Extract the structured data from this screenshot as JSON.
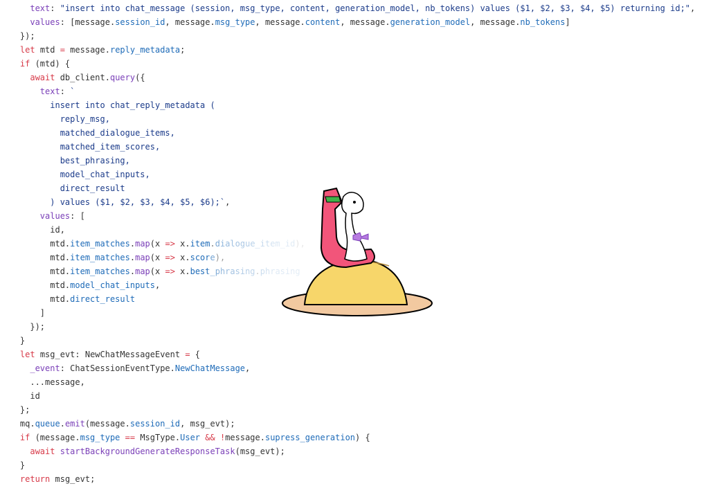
{
  "editor": {
    "lines": [
      [
        {
          "t": "      "
        },
        {
          "t": "text",
          "c": "prop"
        },
        {
          "t": ": "
        },
        {
          "t": "\"insert into chat_message (session, msg_type, content, generation_model, nb_tokens) values ($1, $2, $3, $4, $5) returning id;\"",
          "c": "str"
        },
        {
          "t": ","
        }
      ],
      [
        {
          "t": "      "
        },
        {
          "t": "values",
          "c": "prop"
        },
        {
          "t": ": [message."
        },
        {
          "t": "session_id",
          "c": "field"
        },
        {
          "t": ", message."
        },
        {
          "t": "msg_type",
          "c": "field"
        },
        {
          "t": ", message."
        },
        {
          "t": "content",
          "c": "field"
        },
        {
          "t": ", message."
        },
        {
          "t": "generation_model",
          "c": "field"
        },
        {
          "t": ", message."
        },
        {
          "t": "nb_tokens",
          "c": "field"
        },
        {
          "t": "]"
        }
      ],
      [
        {
          "t": "    });"
        }
      ],
      [
        {
          "t": "    "
        },
        {
          "t": "let",
          "c": "kw"
        },
        {
          "t": " mtd "
        },
        {
          "t": "=",
          "c": "op"
        },
        {
          "t": " message."
        },
        {
          "t": "reply_metadata",
          "c": "field"
        },
        {
          "t": ";"
        }
      ],
      [
        {
          "t": "    "
        },
        {
          "t": "if",
          "c": "kw"
        },
        {
          "t": " (mtd) {"
        }
      ],
      [
        {
          "t": "      "
        },
        {
          "t": "await",
          "c": "kw"
        },
        {
          "t": " db_client."
        },
        {
          "t": "query",
          "c": "fn"
        },
        {
          "t": "({"
        }
      ],
      [
        {
          "t": "        "
        },
        {
          "t": "text",
          "c": "prop"
        },
        {
          "t": ": "
        },
        {
          "t": "`",
          "c": "str"
        }
      ],
      [
        {
          "t": "          "
        },
        {
          "t": "insert into chat_reply_metadata (",
          "c": "str"
        }
      ],
      [
        {
          "t": "            "
        },
        {
          "t": "reply_msg,",
          "c": "str"
        }
      ],
      [
        {
          "t": "            "
        },
        {
          "t": "matched_dialogue_items,",
          "c": "str"
        }
      ],
      [
        {
          "t": "            "
        },
        {
          "t": "matched_item_scores,",
          "c": "str"
        }
      ],
      [
        {
          "t": "            "
        },
        {
          "t": "best_phrasing,",
          "c": "str"
        }
      ],
      [
        {
          "t": "            "
        },
        {
          "t": "model_chat_inputs,",
          "c": "str"
        }
      ],
      [
        {
          "t": "            "
        },
        {
          "t": "direct_result",
          "c": "str"
        }
      ],
      [
        {
          "t": "          "
        },
        {
          "t": ") values ($1, $2, $3, $4, $5, $6);`",
          "c": "str"
        },
        {
          "t": ","
        }
      ],
      [
        {
          "t": "        "
        },
        {
          "t": "values",
          "c": "prop"
        },
        {
          "t": ": ["
        }
      ],
      [
        {
          "t": "          id,"
        }
      ],
      [
        {
          "t": "          mtd."
        },
        {
          "t": "item_matches",
          "c": "field"
        },
        {
          "t": "."
        },
        {
          "t": "map",
          "c": "fn"
        },
        {
          "t": "(x "
        },
        {
          "t": "=>",
          "c": "op"
        },
        {
          "t": " x."
        },
        {
          "t": "item",
          "c": "field"
        },
        {
          "t": "."
        },
        {
          "t": "dialogue_item_id",
          "c": "field"
        },
        {
          "t": "),"
        }
      ],
      [
        {
          "t": "          mtd."
        },
        {
          "t": "item_matches",
          "c": "field"
        },
        {
          "t": "."
        },
        {
          "t": "map",
          "c": "fn"
        },
        {
          "t": "(x "
        },
        {
          "t": "=>",
          "c": "op"
        },
        {
          "t": " x."
        },
        {
          "t": "score",
          "c": "field"
        },
        {
          "t": "),"
        }
      ],
      [
        {
          "t": "          mtd."
        },
        {
          "t": "item_matches",
          "c": "field"
        },
        {
          "t": "."
        },
        {
          "t": "map",
          "c": "fn"
        },
        {
          "t": "(x "
        },
        {
          "t": "=>",
          "c": "op"
        },
        {
          "t": " x."
        },
        {
          "t": "best_phrasing",
          "c": "field"
        },
        {
          "t": "."
        },
        {
          "t": "phrasing",
          "c": "field"
        }
      ],
      [
        {
          "t": "          mtd."
        },
        {
          "t": "model_chat_inputs",
          "c": "field"
        },
        {
          "t": ","
        }
      ],
      [
        {
          "t": "          mtd."
        },
        {
          "t": "direct_result",
          "c": "field"
        }
      ],
      [
        {
          "t": "        ]"
        }
      ],
      [
        {
          "t": "      });"
        }
      ],
      [
        {
          "t": "    }"
        }
      ],
      [
        {
          "t": "    "
        },
        {
          "t": "let",
          "c": "kw"
        },
        {
          "t": " msg_evt: NewChatMessageEvent "
        },
        {
          "t": "=",
          "c": "op"
        },
        {
          "t": " {"
        }
      ],
      [
        {
          "t": "      "
        },
        {
          "t": "_event",
          "c": "prop"
        },
        {
          "t": ": ChatSessionEventType."
        },
        {
          "t": "NewChatMessage",
          "c": "field"
        },
        {
          "t": ","
        }
      ],
      [
        {
          "t": "      ...message,"
        }
      ],
      [
        {
          "t": "      id"
        }
      ],
      [
        {
          "t": "    };"
        }
      ],
      [
        {
          "t": "    mq."
        },
        {
          "t": "queue",
          "c": "field"
        },
        {
          "t": "."
        },
        {
          "t": "emit",
          "c": "fn"
        },
        {
          "t": "(message."
        },
        {
          "t": "session_id",
          "c": "field"
        },
        {
          "t": ", msg_evt);"
        }
      ],
      [
        {
          "t": "    "
        },
        {
          "t": "if",
          "c": "kw"
        },
        {
          "t": " (message."
        },
        {
          "t": "msg_type",
          "c": "field"
        },
        {
          "t": " "
        },
        {
          "t": "==",
          "c": "op"
        },
        {
          "t": " MsgType."
        },
        {
          "t": "User",
          "c": "field"
        },
        {
          "t": " "
        },
        {
          "t": "&&",
          "c": "op"
        },
        {
          "t": " "
        },
        {
          "t": "!",
          "c": "op"
        },
        {
          "t": "message."
        },
        {
          "t": "supress_generation",
          "c": "field"
        },
        {
          "t": ") {"
        }
      ],
      [
        {
          "t": "      "
        },
        {
          "t": "await",
          "c": "kw"
        },
        {
          "t": " "
        },
        {
          "t": "startBackgroundGenerateResponseTask",
          "c": "fn"
        },
        {
          "t": "(msg_evt);"
        }
      ],
      [
        {
          "t": "    }"
        }
      ],
      [
        {
          "t": "    "
        },
        {
          "t": "return",
          "c": "kw"
        },
        {
          "t": " msg_evt;"
        }
      ]
    ]
  },
  "overlay": {
    "icon": "mascot-figure-on-sand-dome-icon",
    "colors": {
      "figure": "#f2557a",
      "dome": "#f7d66a",
      "plate": "#f2c9a0",
      "accent_band": "#3fb24a",
      "bow": "#b77be0"
    }
  }
}
